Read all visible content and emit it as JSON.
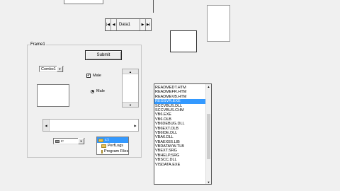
{
  "data_control": {
    "caption": "Data1",
    "first_icon": "move-first-icon",
    "prev_icon": "move-previous-icon",
    "next_icon": "move-next-icon",
    "last_icon": "move-last-icon",
    "first_glyph": "|◀",
    "prev_glyph": "◀",
    "next_glyph": "▶",
    "last_glyph": "▶|"
  },
  "frame": {
    "title": "Frame1",
    "submit_label": "Submit",
    "combo_value": "Combo1",
    "checkbox_label": "Male",
    "checkbox_checked": true,
    "option_label": "Male",
    "option_selected": true
  },
  "drive": {
    "value": "c:"
  },
  "dir_tree": {
    "items": [
      {
        "label": "c:\\",
        "selected": true
      },
      {
        "label": "PerfLogs",
        "selected": false
      },
      {
        "label": "Program Files",
        "selected": false
      }
    ]
  },
  "file_list": {
    "items": [
      {
        "label": "READMEDT.HTM",
        "selected": false
      },
      {
        "label": "READMEFR.HTM",
        "selected": false
      },
      {
        "label": "READMEVB.HTM",
        "selected": false
      },
      {
        "label": "REGSVR.EXE",
        "selected": true
      },
      {
        "label": "SCCVBUS.DLL",
        "selected": false
      },
      {
        "label": "SCCVBUS.CHM",
        "selected": false
      },
      {
        "label": "VB6.EXE",
        "selected": false
      },
      {
        "label": "VB6.OLB",
        "selected": false
      },
      {
        "label": "VB6DEBUG.DLL",
        "selected": false
      },
      {
        "label": "VB6EXT.OLB",
        "selected": false
      },
      {
        "label": "VB6IDE.DLL",
        "selected": false
      },
      {
        "label": "VBA6.DLL",
        "selected": false
      },
      {
        "label": "VBAEXE6.LIB",
        "selected": false
      },
      {
        "label": "VBDATAVW.TLB",
        "selected": false
      },
      {
        "label": "VBEXT.SRG",
        "selected": false
      },
      {
        "label": "VBHELP.SRG",
        "selected": false
      },
      {
        "label": "VBSCC.DLL",
        "selected": false
      },
      {
        "label": "VISDATA.EXE",
        "selected": false
      }
    ]
  },
  "scroll_glyphs": {
    "up": "▲",
    "down": "▼",
    "left": "◀",
    "right": "▶"
  },
  "colors": {
    "selection": "#3399ff",
    "background": "#f0f0f0"
  }
}
